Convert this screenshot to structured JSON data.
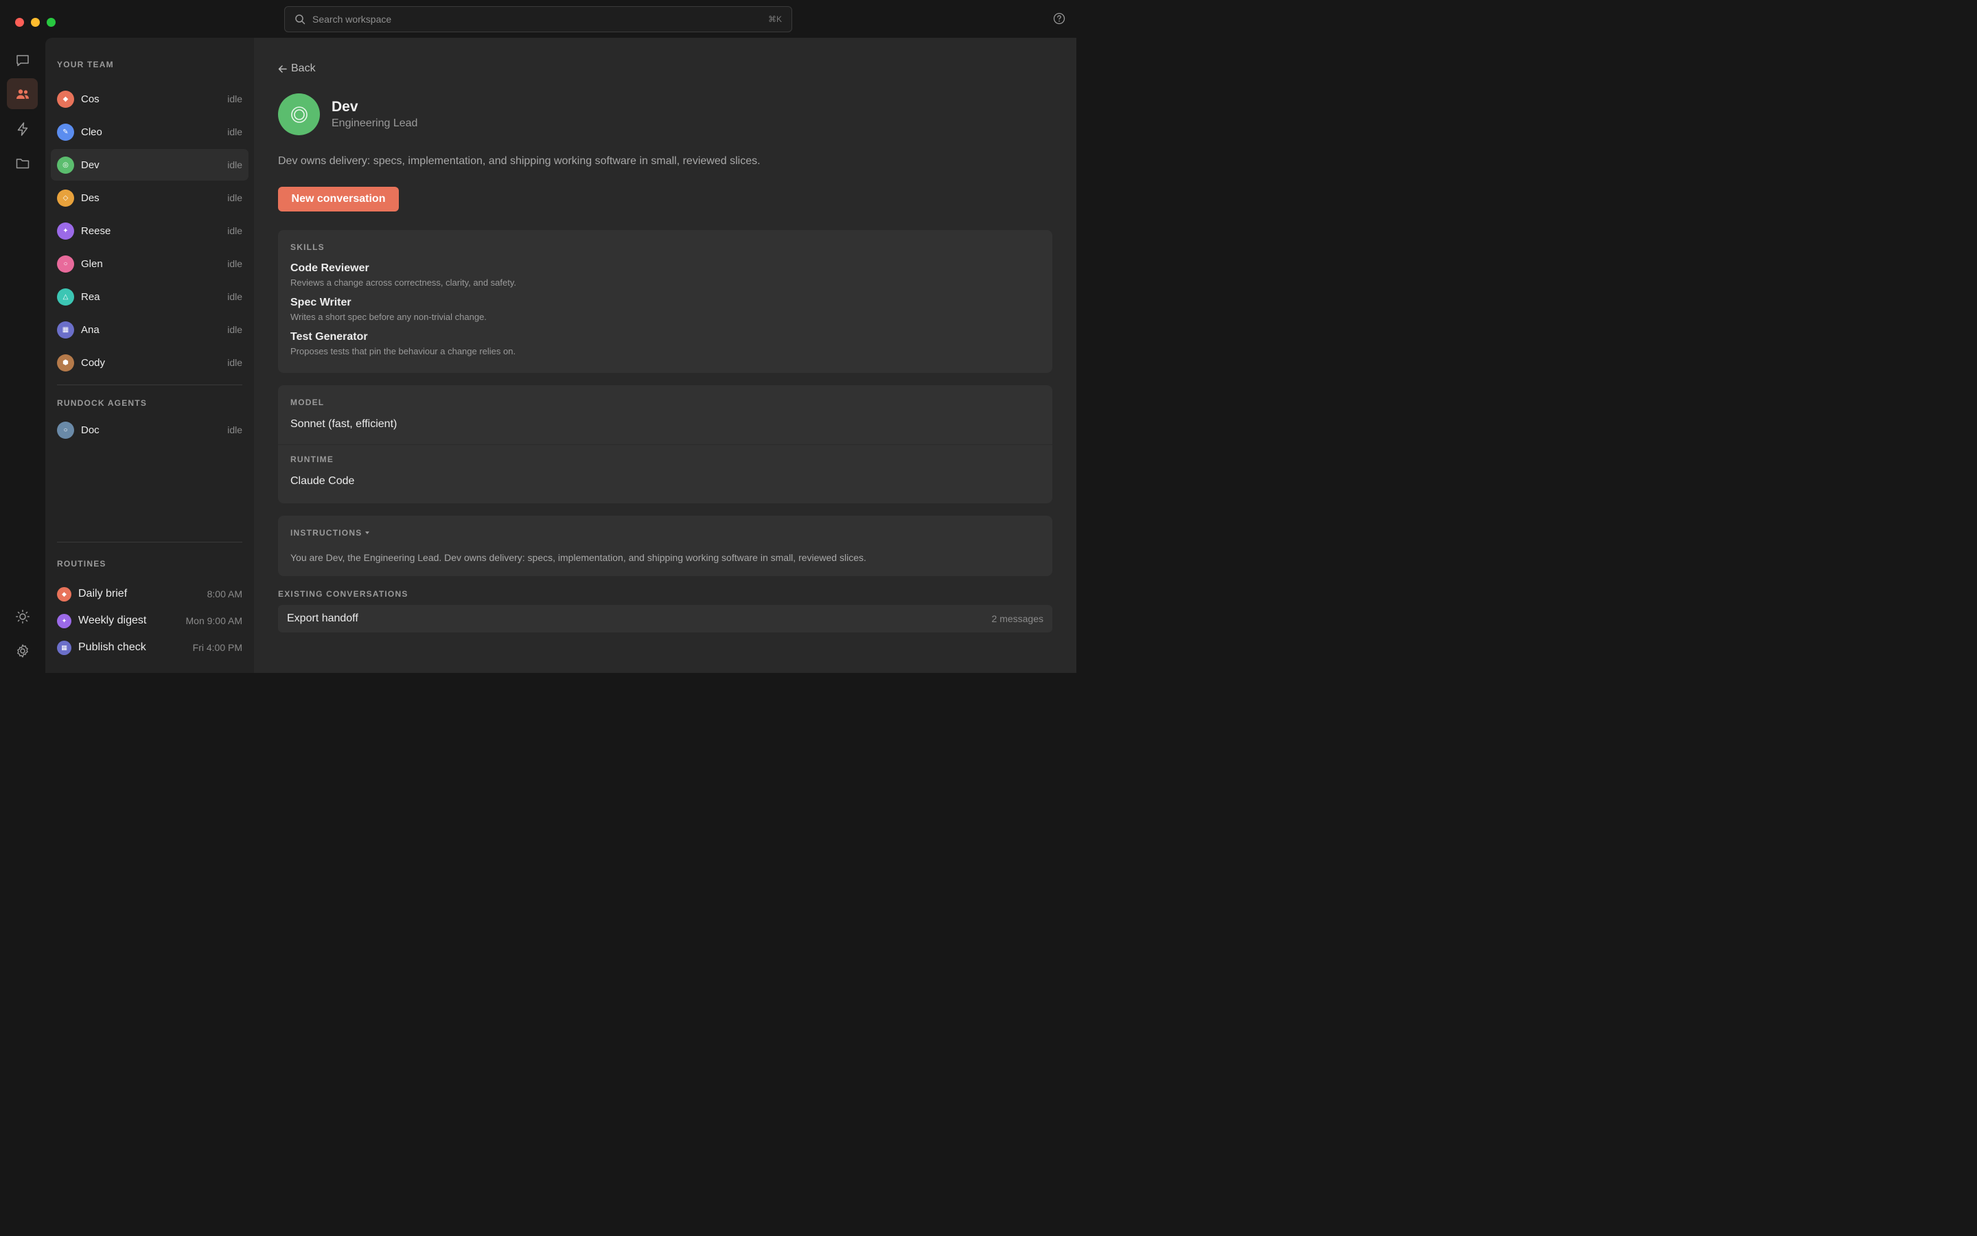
{
  "search": {
    "placeholder": "Search workspace",
    "shortcut": "⌘K"
  },
  "sidebar": {
    "team_label": "YOUR TEAM",
    "team": [
      {
        "name": "Cos",
        "status": "idle",
        "color": "#e8735a",
        "glyph": "◆"
      },
      {
        "name": "Cleo",
        "status": "idle",
        "color": "#5b8def",
        "glyph": "✎"
      },
      {
        "name": "Dev",
        "status": "idle",
        "color": "#5bbd6e",
        "glyph": "◎"
      },
      {
        "name": "Des",
        "status": "idle",
        "color": "#e8a23c",
        "glyph": "◇"
      },
      {
        "name": "Reese",
        "status": "idle",
        "color": "#9b6ae8",
        "glyph": "✦"
      },
      {
        "name": "Glen",
        "status": "idle",
        "color": "#e86a9b",
        "glyph": "○"
      },
      {
        "name": "Rea",
        "status": "idle",
        "color": "#3cc6b4",
        "glyph": "△"
      },
      {
        "name": "Ana",
        "status": "idle",
        "color": "#6b6fc9",
        "glyph": "▦"
      },
      {
        "name": "Cody",
        "status": "idle",
        "color": "#b57a4a",
        "glyph": "⬢"
      }
    ],
    "agents_label": "RUNDOCK AGENTS",
    "agents": [
      {
        "name": "Doc",
        "status": "idle",
        "color": "#6a8aa8",
        "glyph": "○"
      }
    ],
    "routines_label": "ROUTINES",
    "routines": [
      {
        "name": "Daily brief",
        "time": "8:00 AM",
        "color": "#e8735a",
        "glyph": "◆"
      },
      {
        "name": "Weekly digest",
        "time": "Mon 9:00 AM",
        "color": "#9b6ae8",
        "glyph": "✦"
      },
      {
        "name": "Publish check",
        "time": "Fri 4:00 PM",
        "color": "#6b6fc9",
        "glyph": "▦"
      }
    ]
  },
  "main": {
    "back_label": "Back",
    "agent": {
      "name": "Dev",
      "role": "Engineering Lead",
      "description": "Dev owns delivery: specs, implementation, and shipping working software in small, reviewed slices.",
      "color": "#5bbd6e"
    },
    "cta_label": "New conversation",
    "skills_label": "SKILLS",
    "skills": [
      {
        "name": "Code Reviewer",
        "desc": "Reviews a change across correctness, clarity, and safety."
      },
      {
        "name": "Spec Writer",
        "desc": "Writes a short spec before any non-trivial change."
      },
      {
        "name": "Test Generator",
        "desc": "Proposes tests that pin the behaviour a change relies on."
      }
    ],
    "model_label": "MODEL",
    "model_value": "Sonnet (fast, efficient)",
    "runtime_label": "RUNTIME",
    "runtime_value": "Claude Code",
    "instructions_label": "INSTRUCTIONS",
    "instructions_text": "You are Dev, the Engineering Lead. Dev owns delivery: specs, implementation, and shipping working software in small, reviewed slices.",
    "conversations_label": "EXISTING CONVERSATIONS",
    "conversations": [
      {
        "title": "Export handoff",
        "count": "2 messages"
      }
    ]
  },
  "colors": {
    "accent": "#e8735a",
    "background": "#171717",
    "panel": "#232323",
    "main": "#292929",
    "card": "#323232"
  }
}
